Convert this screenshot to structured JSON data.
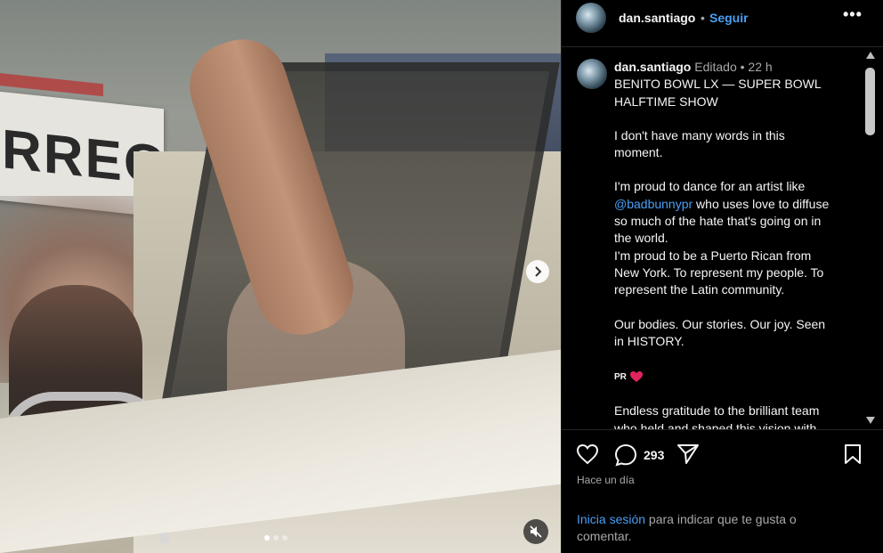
{
  "media": {
    "sign_text": "RREO",
    "carousel_dots": 3,
    "active_dot": 0,
    "next_icon": "chevron-right-icon",
    "mute_icon": "speaker-muted-icon"
  },
  "header": {
    "username": "dan.santiago",
    "bullet": "•",
    "follow_label": "Seguir",
    "more_label": "•••"
  },
  "caption": {
    "username": "dan.santiago",
    "edited": "Editado",
    "bullet": "•",
    "time": "22 h",
    "lines": {
      "l1": "BENITO BOWL LX — SUPER BOWL",
      "l2": "HALFTIME SHOW",
      "l3": "I don't have many words in this",
      "l4": "moment.",
      "l5": "I'm proud to dance for an artist like",
      "mention": "@badbunnypr",
      "l6": " who uses love to diffuse",
      "l7": "so much of the hate that's going on in",
      "l8": "the world.",
      "l9": "I'm proud to be a Puerto Rican from",
      "l10": "New York. To represent my people. To",
      "l11": "represent the Latin community.",
      "l12": "Our bodies. Our stories. Our joy. Seen",
      "l13": "in HISTORY.",
      "pr": "PR",
      "l14": "Endless gratitude to the brilliant team",
      "l15": "who held and shaped this vision with"
    }
  },
  "actions": {
    "comment_count": "293",
    "like_icon": "heart-icon",
    "comment_icon": "comment-icon",
    "share_icon": "send-icon",
    "save_icon": "bookmark-icon"
  },
  "timestamp": "Hace un día",
  "login_prompt": {
    "link": "Inicia sesión",
    "rest": " para indicar que te gusta o comentar."
  }
}
